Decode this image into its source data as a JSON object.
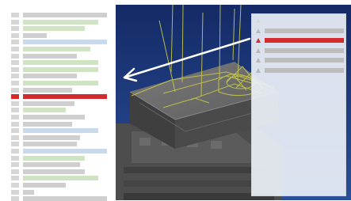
{
  "colors": {
    "highlight": "#d42c2c",
    "bar_gray": "#cfcfcf",
    "bar_green": "#cfe4c3",
    "bar_blue": "#c9daec",
    "viewport_bg": "#1e3b7f",
    "model_gray": "#5b5b5b",
    "wire_yellow": "#c7c84a",
    "right_panel_bg": "#eaeef6"
  },
  "left_list": {
    "selected_index": 12,
    "rows": [
      {
        "tone": "gray"
      },
      {
        "tone": "green"
      },
      {
        "tone": "green"
      },
      {
        "tone": "gray"
      },
      {
        "tone": "blue"
      },
      {
        "tone": "green"
      },
      {
        "tone": "gray"
      },
      {
        "tone": "green"
      },
      {
        "tone": "green"
      },
      {
        "tone": "gray"
      },
      {
        "tone": "green"
      },
      {
        "tone": "gray"
      },
      {
        "tone": "red"
      },
      {
        "tone": "gray"
      },
      {
        "tone": "green"
      },
      {
        "tone": "gray"
      },
      {
        "tone": "gray"
      },
      {
        "tone": "blue"
      },
      {
        "tone": "gray"
      },
      {
        "tone": "gray"
      },
      {
        "tone": "blue"
      },
      {
        "tone": "green"
      },
      {
        "tone": "gray"
      },
      {
        "tone": "gray"
      },
      {
        "tone": "green"
      },
      {
        "tone": "gray"
      },
      {
        "tone": "gray"
      },
      {
        "tone": "gray"
      }
    ]
  },
  "right_list": {
    "selected_index": 2,
    "rows": [
      {
        "tone": "outline"
      },
      {
        "tone": "gray"
      },
      {
        "tone": "red"
      },
      {
        "tone": "gray"
      },
      {
        "tone": "gray"
      },
      {
        "tone": "gray"
      }
    ]
  },
  "icons": {
    "pointer": "arrow-pointer-icon",
    "right_item": "triangle-icon"
  }
}
